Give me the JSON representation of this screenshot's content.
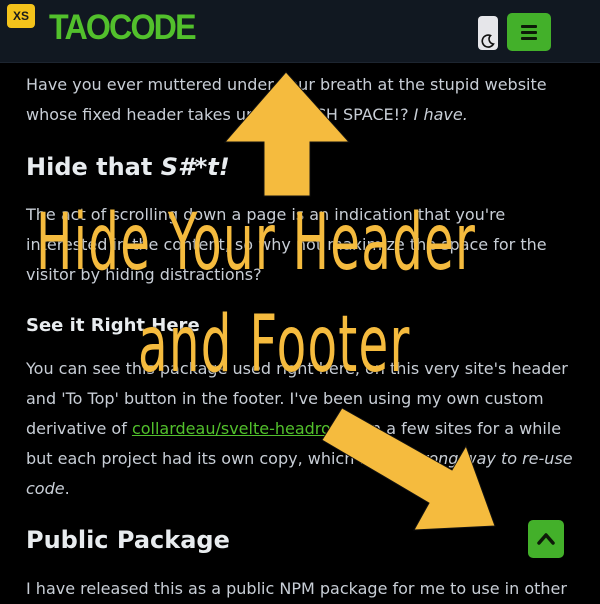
{
  "header": {
    "badge": "XS",
    "logo": "TAOCODE"
  },
  "content": {
    "intro_main": "Have you ever muttered under your breath at the stupid website whose fixed header takes up SO MUCH SPACE!?",
    "intro_em": "I have.",
    "heading_hide_prefix": "Hide that",
    "heading_hide_em": "S#*t!",
    "para_hide": "The act of scrolling down a page is an indication that you're interested in the content, so why not maximize the space for the visitor by hiding distractions?",
    "heading_see": "See it Right Here",
    "para_see_before": "You can see this package used right here, on this very site's header and 'To Top' button in the footer. I've been using my own custom derivative of",
    "para_see_link": "collardeau/svelte-headroom",
    "para_see_mid": "on a few sites for a while but each project had its own copy, which is",
    "para_see_em": "the wrong way to re-use code",
    "para_see_end": ".",
    "heading_public": "Public Package",
    "para_public": "I have released this as a public NPM package for me to use in other"
  },
  "overlay": {
    "line1": "Hide Your Header",
    "line2": "and Footer",
    "color": "#f5bb3e"
  },
  "colors": {
    "accent": "#43b02a",
    "logo": "#52c02c",
    "badge": "#f4c31b",
    "header_bg": "#111821"
  },
  "icons": {
    "theme_toggle": "moon-icon",
    "menu": "hamburger-icon",
    "to_top": "chevron-up-icon"
  }
}
